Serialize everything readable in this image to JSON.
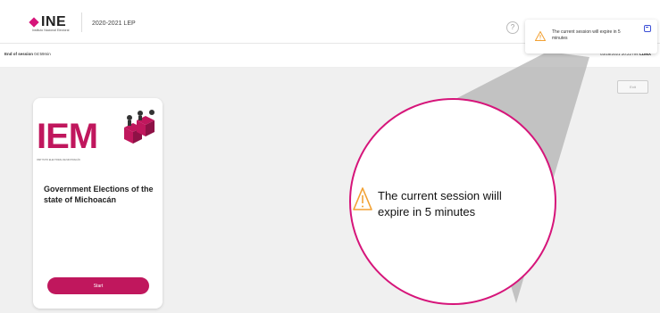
{
  "header": {
    "logo_text": "INE",
    "logo_subtitle": "Instituto Nacional Electoral",
    "process_label": "2020-2021 LEP"
  },
  "session": {
    "label": "End of session",
    "time": "04:59min",
    "datetime": "03/18/2021 20:22 hrs",
    "timezone": "CDMX"
  },
  "actions": {
    "exit_label": "Exit"
  },
  "card": {
    "org_acronym": "IEM",
    "org_caption": "INSTITUTO ELECTORAL DE MICHOACÁN",
    "title": "Government Elections of the state of Michoacán",
    "start_label": "Start"
  },
  "toast": {
    "message": "The current session will expire in 5 minutes"
  },
  "magnified": {
    "message": "The current session wiill expire in 5 minutes"
  },
  "colors": {
    "brand": "#c0175d",
    "accent": "#d6157a",
    "warning": "#f2a133",
    "close": "#3b4fd6"
  }
}
